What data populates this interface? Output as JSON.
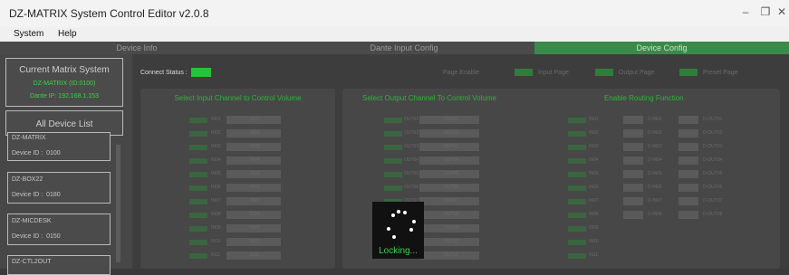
{
  "window": {
    "title": "DZ-MATRIX System Control Editor v2.0.8"
  },
  "menu": {
    "items": [
      "System",
      "Help"
    ]
  },
  "tabs": [
    {
      "label": "Device Info",
      "active": false
    },
    {
      "label": "Dante Input Config",
      "active": false
    },
    {
      "label": "Device Config",
      "active": true
    }
  ],
  "sidebar": {
    "current_title": "Current Matrix System",
    "current_device": "DZ-MATRIX (ID:0100)",
    "dante_ip": "Dante IP: 192.168.1.153",
    "list_title": "All Device List",
    "devices": [
      {
        "name": "DZ-MATRIX",
        "id": "Device ID :  0100"
      },
      {
        "name": "DZ-BOX22",
        "id": "Device ID :  0180"
      },
      {
        "name": "DZ-MICDESK",
        "id": "Device ID :  0150"
      },
      {
        "name": "DZ-CTL2OUT",
        "id": ""
      }
    ]
  },
  "header": {
    "connect_status_label": "Connect Status :",
    "page_enable_label": "Page Enable",
    "input_page": "Input Page",
    "output_page": "Output Page",
    "preset_page": "Preset Page"
  },
  "sections": {
    "input_title": "Select Input Channel to Control Volume",
    "output_title": "Select Output Channel To Control Volume",
    "routing_title": "Enable Routing Function"
  },
  "input_channels": [
    "IN01",
    "IN02",
    "IN03",
    "IN04",
    "IN05",
    "IN06",
    "IN07",
    "IN08",
    "IN09",
    "IN10",
    "IN11"
  ],
  "output_channels": [
    "OUT01",
    "OUT02",
    "OUT03",
    "OUT04",
    "OUT05",
    "OUT06",
    "OUT07",
    "OUT08",
    "OUT09",
    "OUT10",
    "OUT11"
  ],
  "routing": [
    {
      "ch": "IN01",
      "b": "D-IN01",
      "c": "D-OUT01"
    },
    {
      "ch": "IN02",
      "b": "D-IN02",
      "c": "D-OUT02"
    },
    {
      "ch": "IN03",
      "b": "D-IN03",
      "c": "D-OUT03"
    },
    {
      "ch": "IN04",
      "b": "D-IN04",
      "c": "D-OUT04"
    },
    {
      "ch": "IN05",
      "b": "D-IN05",
      "c": "D-OUT05"
    },
    {
      "ch": "IN06",
      "b": "D-IN06",
      "c": "D-OUT06"
    },
    {
      "ch": "IN07",
      "b": "D-IN07",
      "c": "D-OUT07"
    },
    {
      "ch": "IN08",
      "b": "D-IN08",
      "c": "D-OUT08"
    },
    {
      "ch": "IN09",
      "b": "",
      "c": ""
    },
    {
      "ch": "IN10",
      "b": "",
      "c": ""
    },
    {
      "ch": "IN11",
      "b": "",
      "c": ""
    }
  ],
  "loading": {
    "text": "Locking..."
  },
  "colors": {
    "accent": "#3bd24a",
    "active_tab": "#3a8a4a"
  }
}
